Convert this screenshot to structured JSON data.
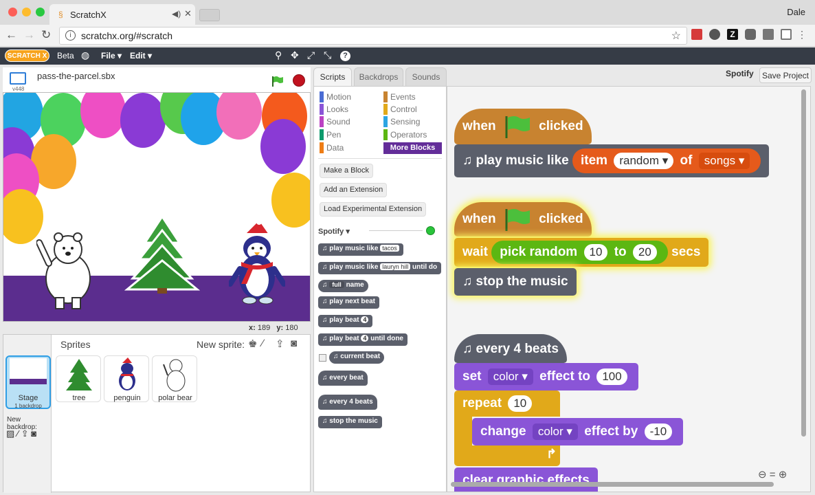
{
  "browser": {
    "tab_title": "ScratchX",
    "url": "scratchx.org/#scratch",
    "user": "Dale"
  },
  "menubar": {
    "logo": "SCRATCH X",
    "beta": "Beta",
    "file": "File ▾",
    "edit": "Edit ▾"
  },
  "stage": {
    "version": "v448",
    "filename": "pass-the-parcel.sbx",
    "x_label": "x:",
    "x_value": "189",
    "y_label": "y:",
    "y_value": "180"
  },
  "sprites_panel": {
    "header": "Sprites",
    "new_sprite": "New sprite:",
    "stage_label": "Stage",
    "stage_sub": "1 backdrop",
    "new_backdrop": "New backdrop:",
    "items": [
      {
        "label": "tree"
      },
      {
        "label": "penguin"
      },
      {
        "label": "polar bear"
      }
    ]
  },
  "tabs": {
    "scripts": "Scripts",
    "backdrops": "Backdrops",
    "sounds": "Sounds"
  },
  "categories": {
    "motion": "Motion",
    "looks": "Looks",
    "sound": "Sound",
    "pen": "Pen",
    "data": "Data",
    "events": "Events",
    "control": "Control",
    "sensing": "Sensing",
    "operators": "Operators",
    "more_blocks": "More Blocks"
  },
  "palette": {
    "make_block": "Make a Block",
    "add_extension": "Add an Extension",
    "load_experimental": "Load Experimental Extension",
    "extension_name": "Spotify ▾",
    "blocks": [
      {
        "text": "♫ play music like",
        "arg": "tacos"
      },
      {
        "text": "♫ play music like",
        "arg": "lauryn hill",
        "tail": "until do"
      },
      {
        "text": "♫",
        "arg": "full",
        "tail": "name"
      },
      {
        "text": "♫ play next beat"
      },
      {
        "text": "♫ play beat",
        "arg": "4"
      },
      {
        "text": "♫ play beat",
        "arg": "4",
        "tail": "until done"
      },
      {
        "text": "♫ current beat"
      },
      {
        "text": "♫ every beat"
      },
      {
        "text": "♫ every 4 beats"
      },
      {
        "text": "♫ stop the music"
      }
    ]
  },
  "header_right": {
    "extension": "Spotify",
    "save_project": "Save Project"
  },
  "scripts": {
    "when": "when",
    "clicked": "clicked",
    "play_music_like": "♫ play music like",
    "item": "item",
    "random": "random ▾",
    "of": "of",
    "songs": "songs ▾",
    "wait": "wait",
    "pick_random": "pick random",
    "min": "10",
    "to": "to",
    "max": "20",
    "secs": "secs",
    "stop_music": "♫ stop the music",
    "every_beats": "♫ every 4 beats",
    "set": "set",
    "color": "color ▾",
    "effect_to": "effect to",
    "set_val": "100",
    "repeat": "repeat",
    "repeat_val": "10",
    "change": "change",
    "effect_by": "effect by",
    "change_val": "-10",
    "clear": "clear graphic effects"
  },
  "colors": {
    "events": "#c88330",
    "spotify": "#5b5f6b",
    "control": "#e1a91a",
    "operators": "#5cb712",
    "looks": "#8a55d7",
    "data": "#ee7d16"
  }
}
